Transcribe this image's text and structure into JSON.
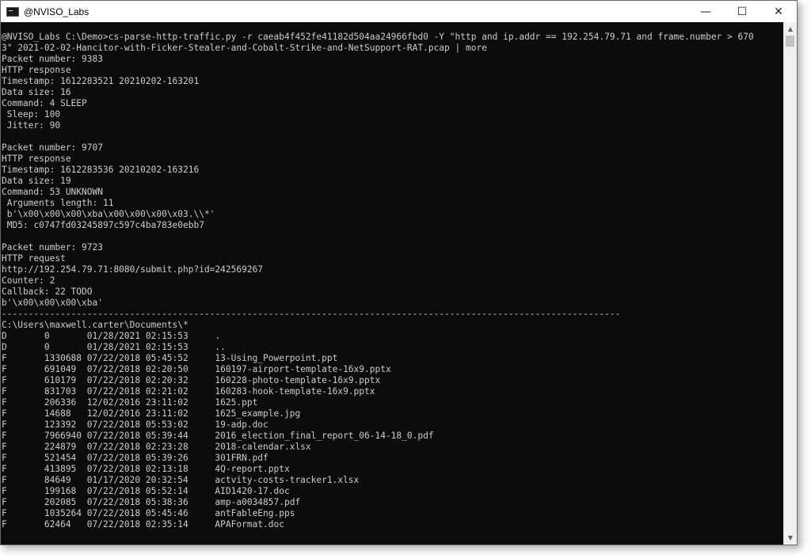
{
  "window": {
    "title": "@NVISO_Labs",
    "minimize_glyph": "—",
    "maximize_glyph": "☐",
    "close_glyph": "✕"
  },
  "console": {
    "lines": [
      "@NVISO_Labs C:\\Demo>cs-parse-http-traffic.py -r caeab4f452fe41182d504aa24966fbd0 -Y \"http and ip.addr == 192.254.79.71 and frame.number > 670",
      "3\" 2021-02-02-Hancitor-with-Ficker-Stealer-and-Cobalt-Strike-and-NetSupport-RAT.pcap | more",
      "Packet number: 9383",
      "HTTP response",
      "Timestamp: 1612283521 20210202-163201",
      "Data size: 16",
      "Command: 4 SLEEP",
      " Sleep: 100",
      " Jitter: 90",
      "",
      "Packet number: 9707",
      "HTTP response",
      "Timestamp: 1612283536 20210202-163216",
      "Data size: 19",
      "Command: 53 UNKNOWN",
      " Arguments length: 11",
      " b'\\x00\\x00\\x00\\xba\\x00\\x00\\x00\\x03.\\\\*'",
      " MD5: c0747fd03245897c597c4ba783e0ebb7",
      "",
      "Packet number: 9723",
      "HTTP request",
      "http://192.254.79.71:8080/submit.php?id=242569267",
      "Counter: 2",
      "Callback: 22 TODO",
      "b'\\x00\\x00\\x00\\xba'",
      "--------------------------------------------------------------------------------------------------------------------",
      "C:\\Users\\maxwell.carter\\Documents\\*",
      "D       0       01/28/2021 02:15:53     .",
      "D       0       01/28/2021 02:15:53     ..",
      "F       1330688 07/22/2018 05:45:52     13-Using_Powerpoint.ppt",
      "F       691049  07/22/2018 02:20:50     160197-airport-template-16x9.pptx",
      "F       610179  07/22/2018 02:20:32     160228-photo-template-16x9.pptx",
      "F       831703  07/22/2018 02:21:02     160283-hook-template-16x9.pptx",
      "F       206336  12/02/2016 23:11:02     1625.ppt",
      "F       14688   12/02/2016 23:11:02     1625_example.jpg",
      "F       123392  07/22/2018 05:53:02     19-adp.doc",
      "F       7966940 07/22/2018 05:39:44     2016_election_final_report_06-14-18_0.pdf",
      "F       224879  07/22/2018 02:23:28     2018-calendar.xlsx",
      "F       521454  07/22/2018 05:39:26     301FRN.pdf",
      "F       413895  07/22/2018 02:13:18     4Q-report.pptx",
      "F       84649   01/17/2020 20:32:54     actvity-costs-tracker1.xlsx",
      "F       199168  07/22/2018 05:52:14     AID1420-17.doc",
      "F       202085  07/22/2018 05:38:36     amp-a0034857.pdf",
      "F       1035264 07/22/2018 05:45:46     antFableEng.pps",
      "F       62464   07/22/2018 02:35:14     APAFormat.doc"
    ]
  }
}
